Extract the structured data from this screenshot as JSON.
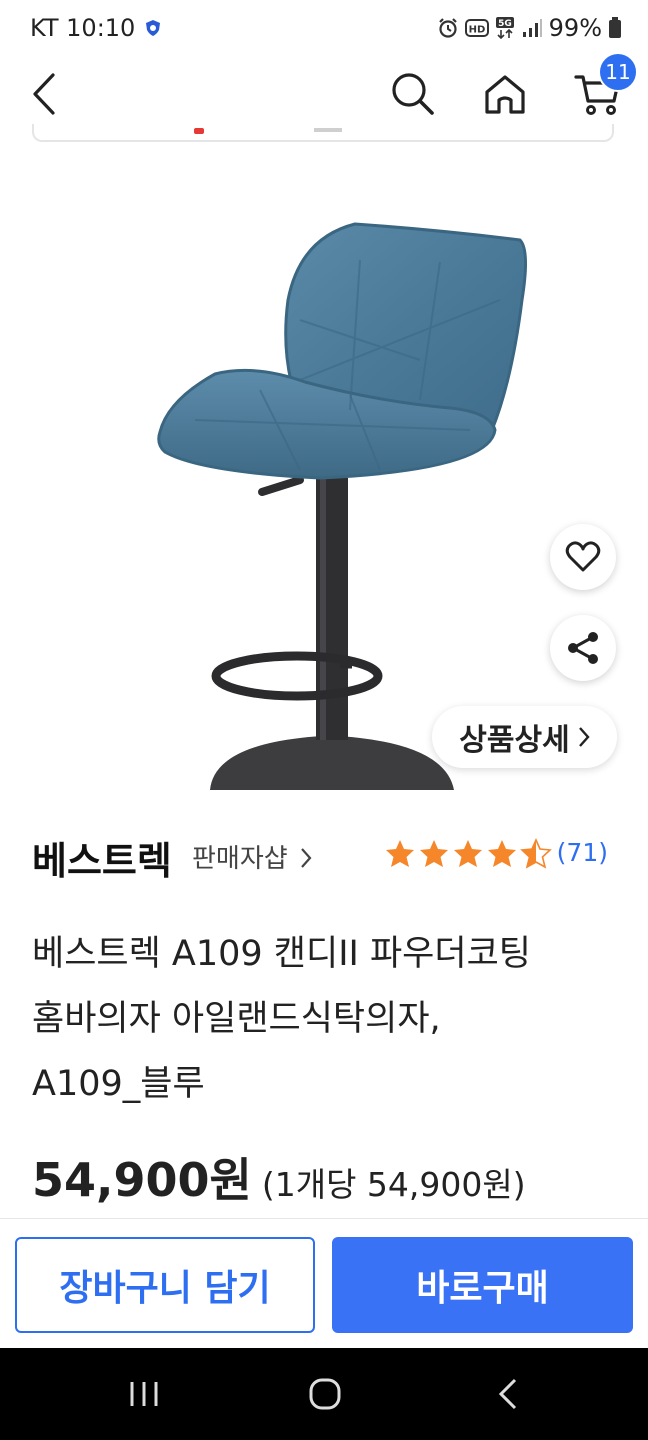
{
  "status_bar": {
    "carrier_time": "KT 10:10",
    "battery": "99%",
    "icons": [
      "shield-icon",
      "alarm-icon",
      "hd-icon",
      "5g-icon",
      "signal-icon",
      "battery-icon"
    ]
  },
  "header": {
    "icons": [
      "back-icon",
      "search-icon",
      "home-icon",
      "cart-icon"
    ],
    "cart_count": "11"
  },
  "image_overlay": {
    "detail_label": "상품상세",
    "icons": [
      "heart-icon",
      "share-icon"
    ]
  },
  "seller": {
    "brand": "베스트렉",
    "shop_link": "판매자샵",
    "rating": 4.5,
    "review_count": "(71)"
  },
  "product": {
    "title": "베스트렉 A109 캔디II 파우더코팅\n홈바의자 아일랜드식탁의자,\nA109_블루",
    "price": "54,900원",
    "unit_price": "(1개당 54,900원)"
  },
  "actions": {
    "add_to_cart": "장바구니 담기",
    "buy_now": "바로구매"
  },
  "colors": {
    "accent": "#3a72f6",
    "badge": "#2e6ff2",
    "star": "#f5862a",
    "chair": "#4f7f9c"
  }
}
